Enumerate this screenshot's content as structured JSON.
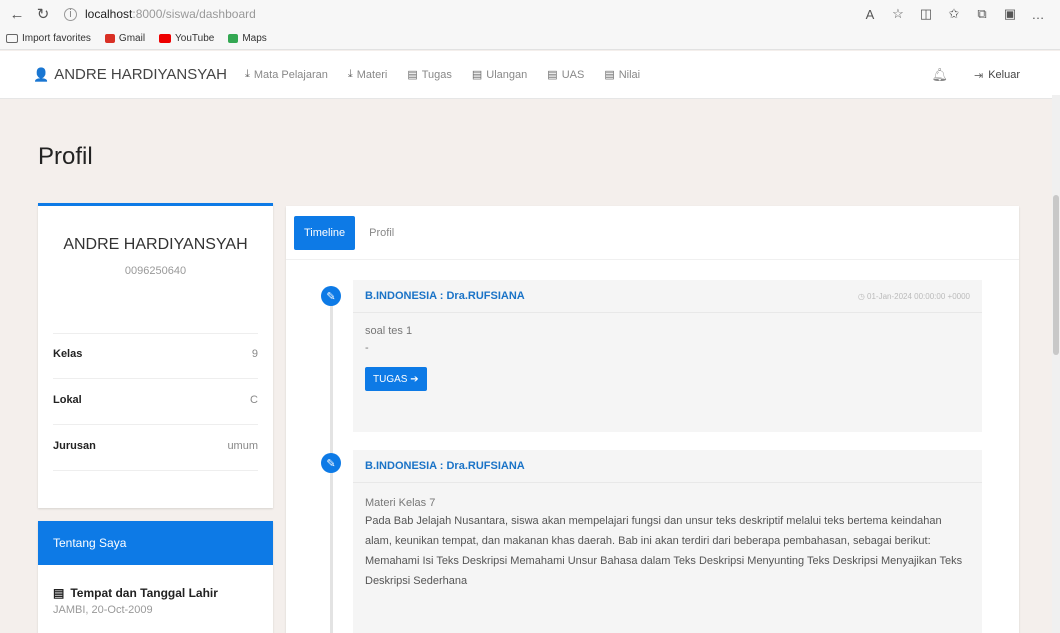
{
  "browser": {
    "url_host": "localhost",
    "url_path": ":8000/siswa/dashboard",
    "bookmarks": [
      "Import favorites",
      "Gmail",
      "YouTube",
      "Maps"
    ]
  },
  "navbar": {
    "brand": "ANDRE HARDIYANSYAH",
    "items": [
      "Mata Pelajaran",
      "Materi",
      "Tugas",
      "Ulangan",
      "UAS",
      "Nilai"
    ],
    "logout": "Keluar"
  },
  "page": {
    "title": "Profil"
  },
  "profile": {
    "name": "ANDRE HARDIYANSYAH",
    "nis": "0096250640",
    "rows": [
      {
        "label": "Kelas",
        "value": "9"
      },
      {
        "label": "Lokal",
        "value": "C"
      },
      {
        "label": "Jurusan",
        "value": "umum"
      }
    ]
  },
  "about": {
    "title": "Tentang Saya",
    "birth_label": "Tempat dan Tanggal Lahir",
    "birth_value": "JAMBI, 20-Oct-2009"
  },
  "tabs": {
    "active": "Timeline",
    "other": "Profil"
  },
  "timeline": [
    {
      "subject": "B.INDONESIA : Dra.RUFSIANA",
      "time": "01-Jan-2024 00:00:00 +0000",
      "title": "soal tes 1",
      "note": "-",
      "button": "TUGAS ➔"
    },
    {
      "subject": "B.INDONESIA : Dra.RUFSIANA",
      "title": "Materi Kelas 7",
      "desc": "Pada Bab Jelajah Nusantara, siswa akan mempelajari fungsi dan unsur teks deskriptif melalui teks bertema keindahan alam, keunikan tempat, dan makanan khas daerah. Bab ini akan terdiri dari beberapa pembahasan, sebagai berikut: Memahami Isi Teks Deskripsi Memahami Unsur Bahasa dalam Teks Deskripsi Menyunting Teks Deskripsi Menyajikan Teks Deskripsi Sederhana"
    }
  ],
  "colors": {
    "primary": "#0d7ae6",
    "background": "#f4efec"
  }
}
